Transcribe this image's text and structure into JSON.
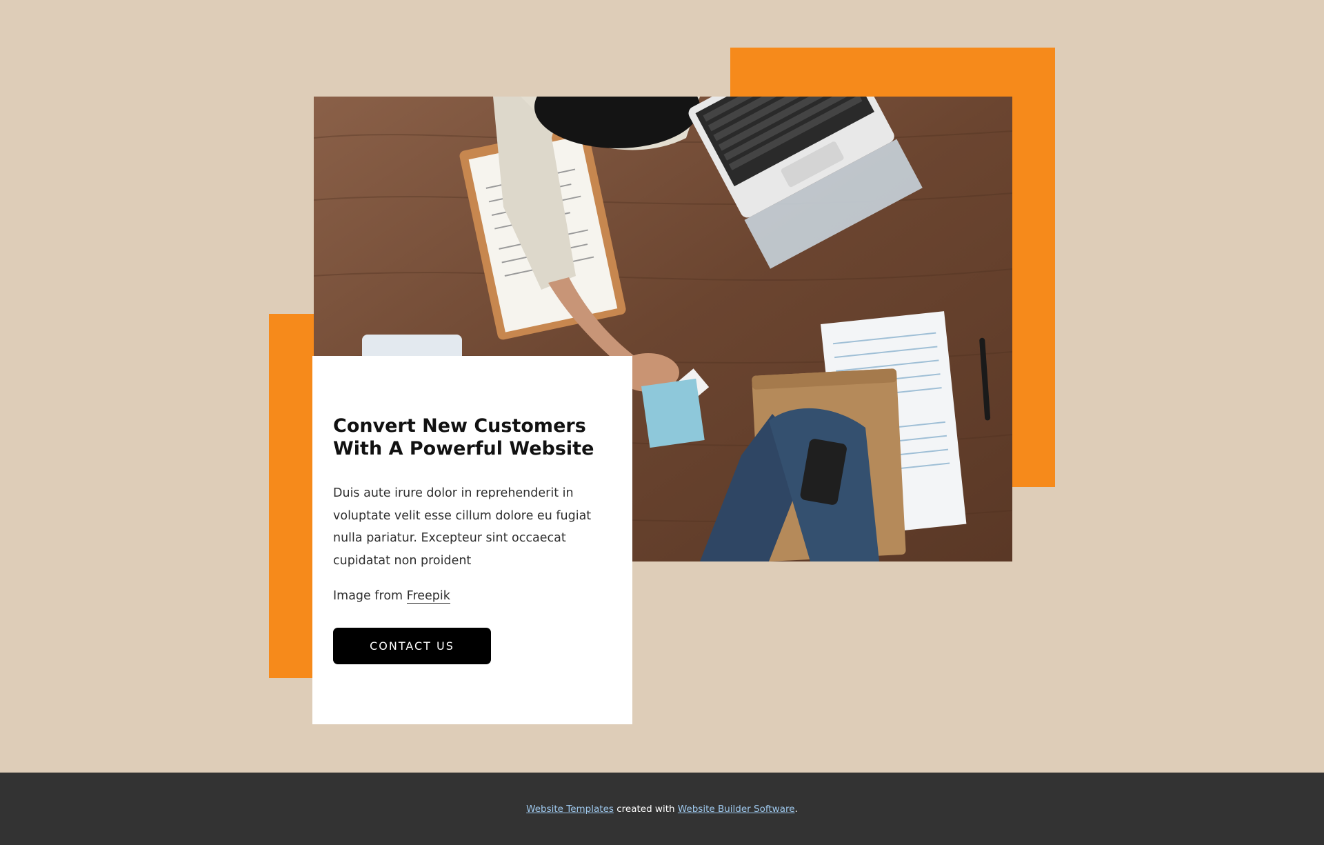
{
  "colors": {
    "background": "#decdb8",
    "accent": "#f68a1b",
    "card": "#ffffff",
    "button": "#000000",
    "footer": "#333333",
    "footer_link": "#9fc9ee"
  },
  "feature": {
    "title": "Convert New Customers With A Powerful Website",
    "body": "Duis aute irure dolor in reprehenderit in voluptate velit esse cillum dolore eu fugiat nulla pariatur. Excepteur sint occaecat cupidatat non proident",
    "credit_prefix": "Image from ",
    "credit_link": "Freepik",
    "button_label": "CONTACT US",
    "image_icon": "business-handshake-photo"
  },
  "footer": {
    "link1": "Website Templates",
    "middle": " created with ",
    "link2": "Website Builder Software",
    "end": "."
  }
}
